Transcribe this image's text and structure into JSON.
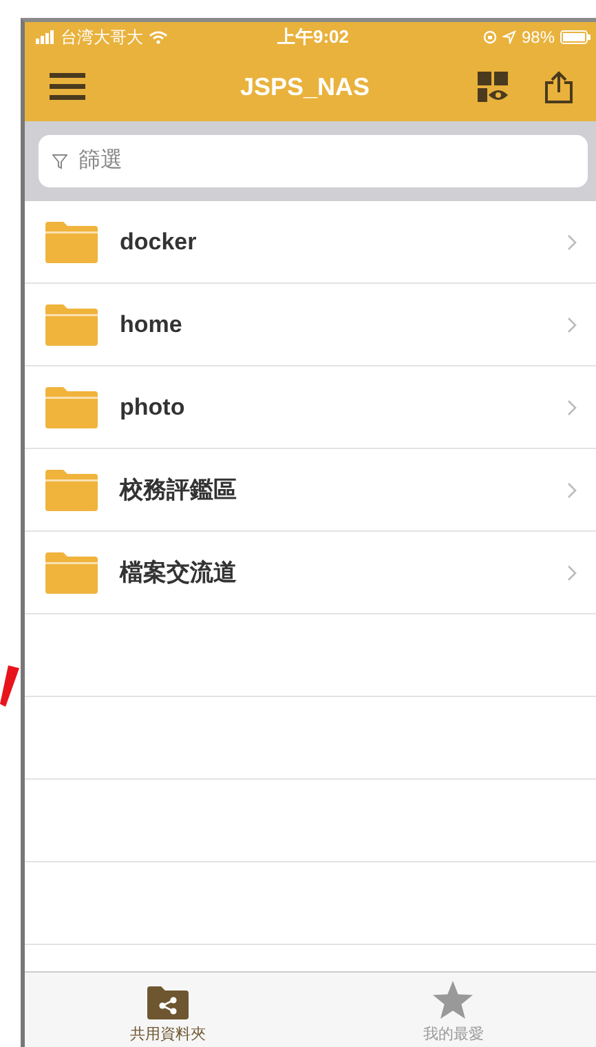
{
  "status_bar": {
    "carrier": "台湾大哥大",
    "time": "上午9:02",
    "battery": "98%"
  },
  "nav_bar": {
    "title": "JSPS_NAS"
  },
  "filter": {
    "placeholder": "篩選"
  },
  "folders": [
    {
      "name": "docker"
    },
    {
      "name": "home"
    },
    {
      "name": "photo"
    },
    {
      "name": "校務評鑑區"
    },
    {
      "name": "檔案交流道"
    }
  ],
  "tab_bar": [
    {
      "label": "共用資料夾",
      "kind": "shared",
      "selected": true
    },
    {
      "label": "我的最愛",
      "kind": "favorites",
      "selected": false
    }
  ]
}
